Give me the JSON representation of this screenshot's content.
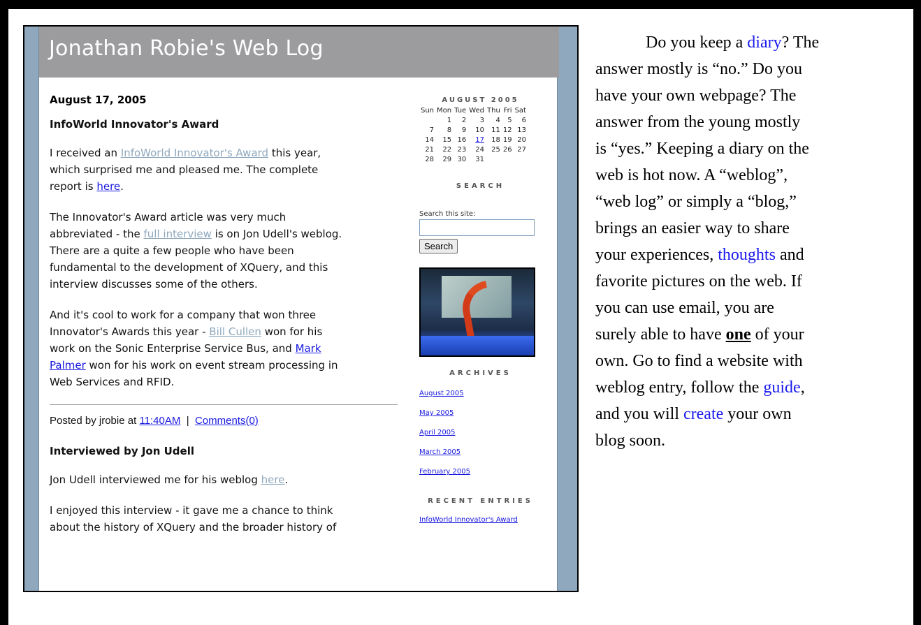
{
  "blog": {
    "title": "Jonathan Robie's Web Log",
    "post1": {
      "date": "August 17, 2005",
      "title": "InfoWorld Innovator's Award",
      "p1_a": "I received an ",
      "p1_link": "InfoWorld Innovator's Award",
      "p1_b": " this year,",
      "p1_c": "which surprised me and pleased me. The complete",
      "p1_d": "report is ",
      "p1_link2": "here",
      "p1_e": ".",
      "p2_a": "The Innovator's Award article was very much",
      "p2_b": "abbreviated - the ",
      "p2_link": "full interview",
      "p2_c": " is on Jon Udell's weblog.",
      "p2_d": "There are a quite a few people who have been",
      "p2_e": "fundamental to the development of XQuery, and this",
      "p2_f": "interview discusses some of the others.",
      "p3_a": "And it's cool to work for a company that won three",
      "p3_b": "Innovator's Awards this year - ",
      "p3_link1": "Bill Cullen",
      "p3_c": " won for his",
      "p3_d": "work on the Sonic Enterprise Service Bus, and ",
      "p3_link2a": "Mark",
      "p3_link2b": "Palmer",
      "p3_e": " won for his work on event stream processing in",
      "p3_f": "Web Services and RFID.",
      "posted_by": "Posted by jrobie at ",
      "time": "11:40AM",
      "sep": "  |  ",
      "comments": "Comments(0)"
    },
    "post2": {
      "title": "Interviewed by Jon Udell",
      "p1_a": "Jon Udell interviewed me for his weblog ",
      "p1_link": "here",
      "p1_b": ".",
      "p2_a": "I enjoyed this interview - it gave me a chance to think",
      "p2_b": "about the history of XQuery and the broader history of"
    },
    "sidebar": {
      "calendar_title": "AUGUST 2005",
      "weekdays": [
        "Sun",
        "Mon",
        "Tue",
        "Wed",
        "Thu",
        "Fri",
        "Sat"
      ],
      "weeks": [
        [
          "",
          "1",
          "2",
          "3",
          "4",
          "5",
          "6"
        ],
        [
          "7",
          "8",
          "9",
          "10",
          "11",
          "12",
          "13"
        ],
        [
          "14",
          "15",
          "16",
          "17",
          "18",
          "19",
          "20"
        ],
        [
          "21",
          "22",
          "23",
          "24",
          "25",
          "26",
          "27"
        ],
        [
          "28",
          "29",
          "30",
          "31",
          "",
          "",
          ""
        ]
      ],
      "linked_day": "17",
      "search_heading": "SEARCH",
      "search_label": "Search this site:",
      "search_button": "Search",
      "archives_heading": "ARCHIVES",
      "archives": [
        "August 2005",
        "May 2005",
        "April 2005",
        "March 2005",
        "February 2005"
      ],
      "recent_heading": "RECENT ENTRIES",
      "recent": [
        "InfoWorld Innovator's Award"
      ]
    }
  },
  "essay": {
    "l1_a": "Do you keep a ",
    "l1_link": "diary",
    "l1_b": "? The",
    "l2": "answer mostly is “no.” Do you",
    "l3": "have your own webpage? The",
    "l4": "answer from the young mostly",
    "l5": "is “yes.” Keeping a diary on the",
    "l6": "web is hot now. A “weblog”,",
    "l7": "“web log” or simply a “blog,”",
    "l8": "brings an easier way to share",
    "l9_a": "your experiences, ",
    "l9_link": "thoughts",
    "l9_b": " and",
    "l10": "favorite pictures on the web. If",
    "l11": "you can use email, you are",
    "l12_a": "surely able to have ",
    "l12_bold": "one",
    "l12_b": " of your",
    "l13": "own. Go to find a website with",
    "l14_a": "weblog entry, follow the ",
    "l14_link": "guide",
    "l14_b": ",",
    "l15_a": "and you will ",
    "l15_link": "create",
    "l15_b": " your own",
    "l16": "blog soon."
  }
}
